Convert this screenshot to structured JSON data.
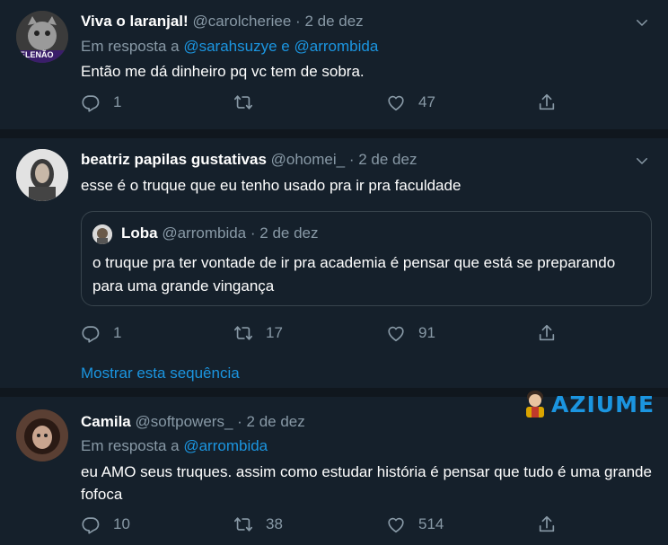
{
  "tweets": [
    {
      "name": "Viva o laranjal!",
      "handle": "@carolcheriee",
      "dot": "·",
      "date": "2 de dez",
      "reply_prefix": "Em resposta a",
      "reply_to_1": "@sarahsuzye",
      "reply_join": "e",
      "reply_to_2": "@arrombida",
      "avatar_badge": "ELENÃO",
      "text": "Então me dá dinheiro pq vc tem de sobra.",
      "replies": "1",
      "retweets": "",
      "likes": "47"
    },
    {
      "name": "beatriz papilas gustativas",
      "handle": "@ohomei_",
      "dot": "·",
      "date": "2 de dez",
      "text": "esse é o truque que eu tenho usado pra ir pra faculdade",
      "quote": {
        "name": "Loba",
        "handle": "@arrombida",
        "dot": "·",
        "date": "2 de dez",
        "text": "o truque pra ter vontade de ir pra academia é pensar que está se preparando para uma grande vingança"
      },
      "replies": "1",
      "retweets": "17",
      "likes": "91",
      "show_thread": "Mostrar esta sequência"
    },
    {
      "name": "Camila",
      "handle": "@softpowers_",
      "dot": "·",
      "date": "2 de dez",
      "reply_prefix": "Em resposta a",
      "reply_to_1": "@arrombida",
      "text": "eu AMO seus truques. assim como estudar história é pensar que tudo é uma grande fofoca",
      "replies": "10",
      "retweets": "38",
      "likes": "514"
    }
  ],
  "watermark": "AZIUME",
  "colors": {
    "bg": "#15202b",
    "separator": "#10171e",
    "accent": "#1b95e0",
    "muted": "#8899a6"
  }
}
